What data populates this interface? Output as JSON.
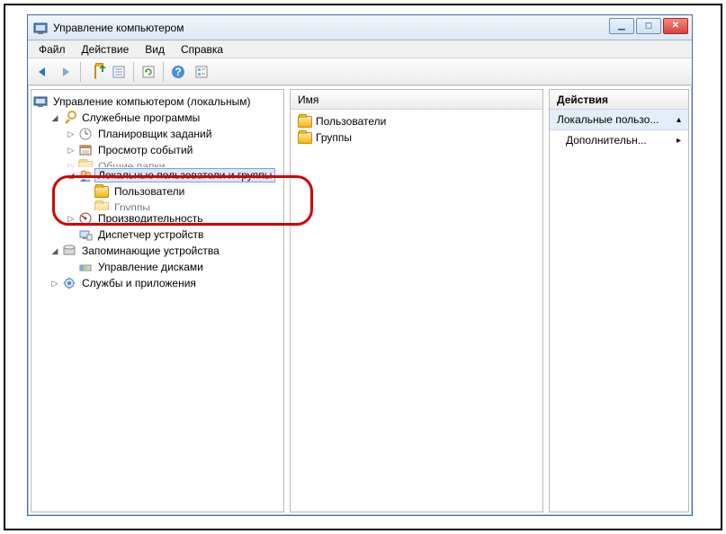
{
  "window": {
    "title": "Управление компьютером"
  },
  "menu": {
    "file": "Файл",
    "action": "Действие",
    "view": "Вид",
    "help": "Справка"
  },
  "toolbar_icons": {
    "back": "back-icon",
    "forward": "forward-icon",
    "up": "up-folder-icon",
    "props": "properties-icon",
    "refresh": "refresh-icon",
    "help": "help-icon",
    "export": "export-list-icon"
  },
  "tree": {
    "root": "Управление компьютером (локальным)",
    "system_tools": "Служебные программы",
    "task_scheduler": "Планировщик заданий",
    "event_viewer": "Просмотр событий",
    "shared_folders_hidden": "Общие папки",
    "local_users_groups": "Локальные пользователи и группы",
    "users": "Пользователи",
    "groups": "Группы",
    "performance": "Производительность",
    "device_manager": "Диспетчер устройств",
    "storage": "Запоминающие устройства",
    "disk_mgmt": "Управление дисками",
    "services_apps": "Службы и приложения"
  },
  "middle": {
    "header": "Имя",
    "item_users": "Пользователи",
    "item_groups": "Группы"
  },
  "actions": {
    "header": "Действия",
    "section": "Локальные пользо...",
    "more": "Дополнительн..."
  }
}
